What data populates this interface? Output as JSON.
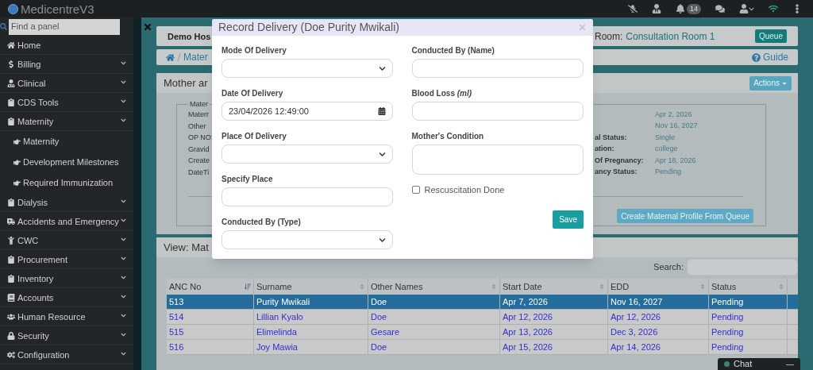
{
  "app": {
    "title": "MedicentreV3",
    "notification_count": "14"
  },
  "sidebar": {
    "search_placeholder": "Find a panel",
    "items": [
      {
        "label": "Home",
        "expandable": false
      },
      {
        "label": "Billing",
        "expandable": true
      },
      {
        "label": "Clinical",
        "expandable": true
      },
      {
        "label": "CDS Tools",
        "expandable": true
      },
      {
        "label": "Maternity",
        "expandable": true,
        "children": [
          {
            "label": "Maternity"
          },
          {
            "label": "Development Milestones"
          },
          {
            "label": "Required Immunization"
          }
        ]
      },
      {
        "label": "Dialysis",
        "expandable": true
      },
      {
        "label": "Accidents and Emergency",
        "expandable": true
      },
      {
        "label": "CWC",
        "expandable": true
      },
      {
        "label": "Procurement",
        "expandable": true
      },
      {
        "label": "Inventory",
        "expandable": true
      },
      {
        "label": "Accounts",
        "expandable": true
      },
      {
        "label": "Human Resource",
        "expandable": true
      },
      {
        "label": "Security",
        "expandable": true
      },
      {
        "label": "Configuration",
        "expandable": true
      }
    ]
  },
  "header": {
    "hospital": "Demo Hos",
    "room_label": "Room:",
    "room": "Consultation Room 1",
    "queue_button": "Queue"
  },
  "breadcrumb": {
    "crumb": "Mater",
    "guide": "Guide"
  },
  "profile_panel": {
    "title": "Mother ar",
    "actions": "Actions",
    "legend": "Mater",
    "left_labels": [
      "Materr",
      "Other",
      "OP NO:",
      "Gravid",
      "Create",
      "DateTi"
    ],
    "right_rows": [
      {
        "value": "Apr 2, 2026"
      },
      {
        "value": "Nov 16, 2027"
      },
      {
        "label": "al Status:",
        "value": "Single"
      },
      {
        "label": "ation:",
        "value": "college"
      },
      {
        "label": "Of Pregnancy:",
        "value": "Apr 18, 2026"
      },
      {
        "label": "ancy Status:",
        "value": "Pending"
      }
    ],
    "create_button": "Create Maternal Profile From Queue"
  },
  "list_panel": {
    "title": "View: Mat",
    "search_label": "Search:",
    "columns": [
      {
        "label": "ANC No",
        "sorted": true
      },
      {
        "label": "Surname",
        "sorted": false
      },
      {
        "label": "Other Names",
        "sorted": false
      },
      {
        "label": "Start Date",
        "sorted": false
      },
      {
        "label": "EDD",
        "sorted": false
      },
      {
        "label": "Status",
        "sorted": false
      }
    ],
    "rows": [
      {
        "selected": true,
        "cells": [
          "513",
          "Purity Mwikali",
          "Doe",
          "Apr 7, 2026",
          "Nov 16, 2027",
          "Pending"
        ]
      },
      {
        "selected": false,
        "cells": [
          "514",
          "Lillian Kyalo",
          "Doe",
          "Apr 12, 2026",
          "Apr 12, 2026",
          "Pending"
        ]
      },
      {
        "selected": false,
        "cells": [
          "515",
          "Elimelinda",
          "Gesare",
          "Apr 13, 2026",
          "Dec 3, 2026",
          "Pending"
        ]
      },
      {
        "selected": false,
        "cells": [
          "516",
          "Joy Mawia",
          "Doe",
          "Apr 15, 2026",
          "Apr 14, 2026",
          "Pending"
        ]
      }
    ]
  },
  "modal": {
    "title": "Record Delivery (Doe Purity Mwikali)",
    "left_fields": [
      {
        "label": "Mode Of Delivery",
        "kind": "select"
      },
      {
        "label": "Date Of Delivery",
        "kind": "datetime",
        "value": "23/04/2026 12:49:00"
      },
      {
        "label": "Place Of Delivery",
        "kind": "select"
      },
      {
        "label": "Specify Place",
        "kind": "text"
      },
      {
        "label": "Conducted By (Type)",
        "kind": "select"
      }
    ],
    "right_fields": [
      {
        "label": "Conducted By (Name)",
        "kind": "text"
      },
      {
        "label": "Blood Loss *(ml)*",
        "kind": "text"
      },
      {
        "label": "Mother's Condition",
        "kind": "textarea"
      }
    ],
    "checkbox": {
      "label": "Rescuscitation Done",
      "checked": false
    },
    "save": "Save"
  },
  "chat": {
    "label": "Chat",
    "minimize": "—"
  }
}
